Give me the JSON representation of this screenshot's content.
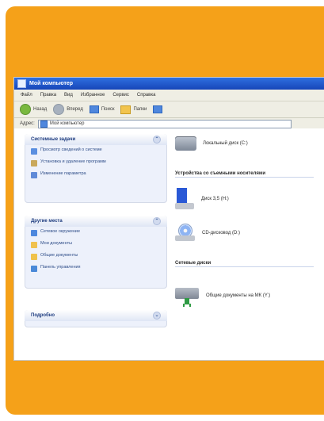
{
  "window": {
    "title": "Мой компьютер",
    "menu": [
      "Файл",
      "Правка",
      "Вид",
      "Избранное",
      "Сервис",
      "Справка"
    ],
    "toolbar": {
      "back": "Назад",
      "forward": "Вперед",
      "search": "Поиск",
      "folders": "Папки"
    },
    "address": {
      "label": "Адрес:",
      "value": "Мой компьютер"
    }
  },
  "sidebar": {
    "system_tasks": {
      "title": "Системные задачи",
      "items": [
        "Просмотр сведений о системе",
        "Установка и удаление программ",
        "Изменение параметра"
      ]
    },
    "other_places": {
      "title": "Другие места",
      "items": [
        "Сетевое окружение",
        "Мои документы",
        "Общие документы",
        "Панель управления"
      ]
    },
    "details": {
      "title": "Подробно"
    }
  },
  "main": {
    "local_disk": "Локальный диск (C:)",
    "removable_section": "Устройства со съемными носителями",
    "drive_h": "Диск 3,5 (H:)",
    "drive_d": "CD-дисковод (D:)",
    "network_section": "Сетевые диски",
    "network_drive": "Общие документы на МК (Y:)"
  },
  "colors": {
    "orange": "#f5a119",
    "title_blue": "#1f58d6",
    "panel_text": "#2e4d88"
  }
}
